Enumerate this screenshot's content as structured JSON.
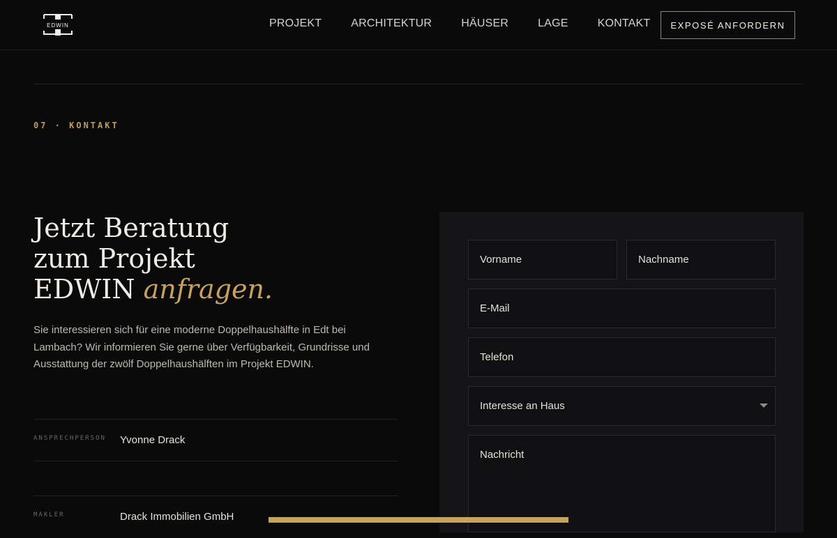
{
  "header": {
    "logo_text": "EDWIN",
    "nav": [
      "PROJEKT",
      "ARCHITEKTUR",
      "HÄUSER",
      "LAGE",
      "KONTAKT"
    ],
    "cta_label": "EXPOSÉ ANFORDERN"
  },
  "section": {
    "label": "07 · KONTAKT"
  },
  "contact": {
    "heading_line1": "Jetzt Beratung",
    "heading_line2": "zum Projekt",
    "heading_line3": "EDWIN",
    "heading_accent": "anfragen.",
    "intro": "Sie interessieren sich für eine moderne Doppelhaushälfte in Edt bei Lambach? Wir informieren Sie gerne über Verfügbarkeit, Grundrisse und Ausstattung der zwölf Doppelhaushälften im Projekt EDWIN.",
    "info": [
      {
        "key": "ANSPRECHPERSON",
        "value": "Yvonne Drack"
      },
      {
        "key": "MAKLER",
        "value": "Drack Immobilien GmbH"
      }
    ]
  },
  "form": {
    "first_name": "Vorname",
    "last_name": "Nachname",
    "email": "E-Mail",
    "phone": "Telefon",
    "house_interest": "Interesse an Haus",
    "message": "Nachricht"
  },
  "colors": {
    "accent": "#c9a15f",
    "background": "#0a0a0a",
    "panel": "#141416"
  }
}
